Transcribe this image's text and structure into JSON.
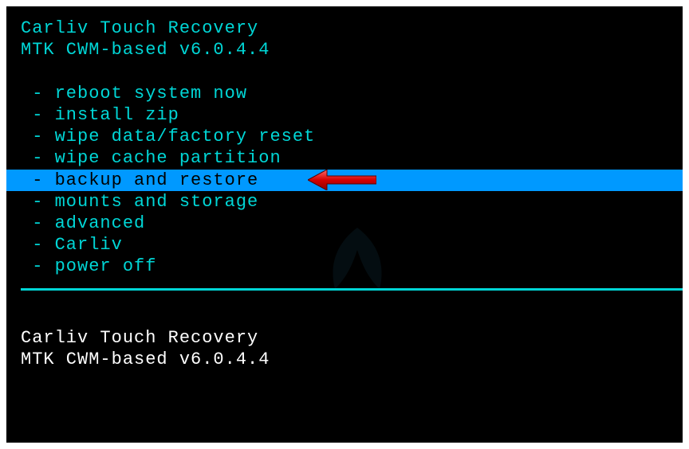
{
  "header": {
    "title": "Carliv Touch Recovery",
    "subtitle": "MTK CWM-based v6.0.4.4"
  },
  "menu": {
    "items": [
      {
        "label": " - reboot system now",
        "selected": false
      },
      {
        "label": " - install zip",
        "selected": false
      },
      {
        "label": " - wipe data/factory reset",
        "selected": false
      },
      {
        "label": " - wipe cache partition",
        "selected": false
      },
      {
        "label": " - backup and restore",
        "selected": true
      },
      {
        "label": " - mounts and storage",
        "selected": false
      },
      {
        "label": " - advanced",
        "selected": false
      },
      {
        "label": " - Carliv",
        "selected": false
      },
      {
        "label": " - power off",
        "selected": false
      }
    ]
  },
  "footer": {
    "line1": "Carliv Touch Recovery",
    "line2": "MTK CWM-based v6.0.4.4"
  },
  "colors": {
    "accent": "#00d6d6",
    "highlight": "#0099ff",
    "bg": "#000000",
    "footerText": "#ffffff",
    "arrow": "#ff0000"
  }
}
